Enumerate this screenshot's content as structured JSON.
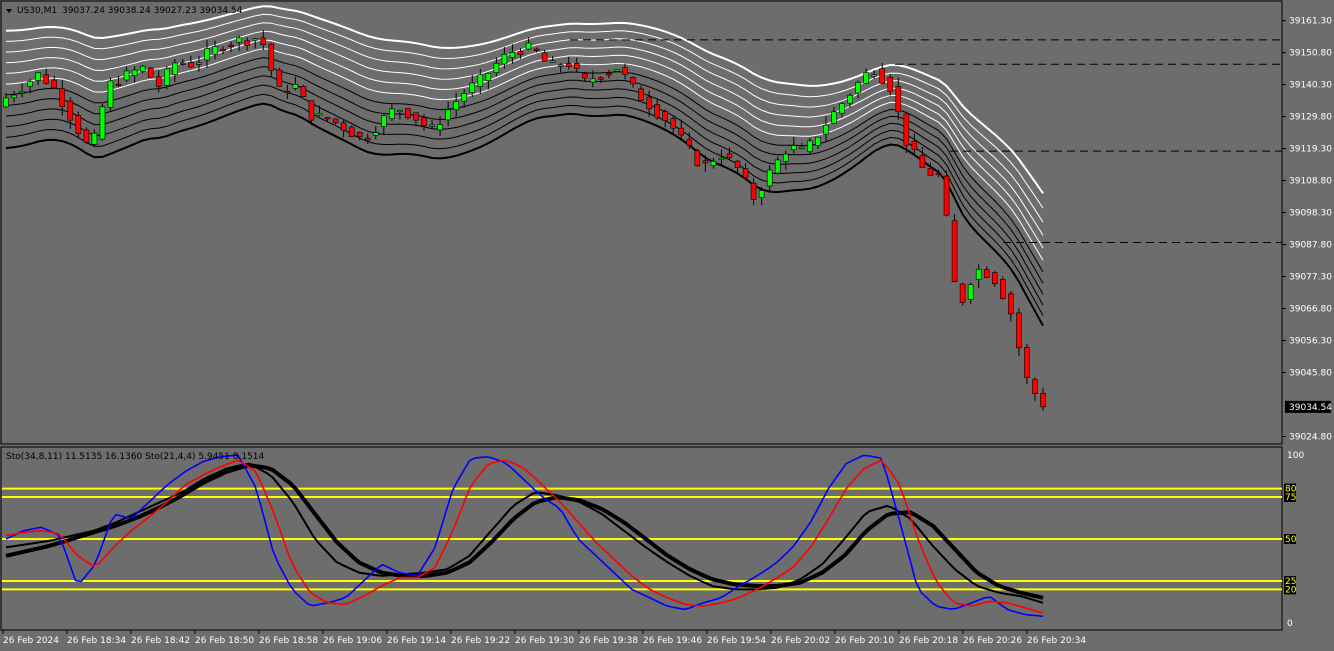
{
  "header": {
    "symbol": "US30,M1",
    "ohlc": "39037.24 39038.24 39027.23 39034.54"
  },
  "indicator": {
    "label": "Sto(34,8,11) 11.5135 16.1360  Sto(21,4,4) 5.9451 8.1514"
  },
  "colors": {
    "background": "#6d6d6d",
    "bull_candle": "#00ff00",
    "bear_candle": "#ff0000",
    "level_line": "#ffff00",
    "stoch_fast_main": "#0000ff",
    "stoch_fast_signal": "#ff0000",
    "stoch_slow_lines": "#000000",
    "ribbon_upper": "#ffffff",
    "ribbon_lower": "#000000"
  },
  "chart_data": [
    {
      "type": "candlestick",
      "title": "US30,M1",
      "price_axis_labels": [
        "39161.30",
        "39150.80",
        "39140.30",
        "39129.80",
        "39119.30",
        "39108.80",
        "39098.30",
        "39087.80",
        "39077.30",
        "39066.80",
        "39056.30",
        "39045.80",
        "39034.54",
        "39024.80"
      ],
      "ylim": [
        39023.0,
        39163.5
      ],
      "current_price": 39034.54,
      "horizontal_dashed_levels": [
        39155.0,
        39147.0,
        39118.5,
        39088.5
      ],
      "x_labels": [
        "26 Feb 2024",
        "26 Feb 18:34",
        "26 Feb 18:42",
        "26 Feb 18:50",
        "26 Feb 18:58",
        "26 Feb 19:06",
        "26 Feb 19:14",
        "26 Feb 19:22",
        "26 Feb 19:30",
        "26 Feb 19:38",
        "26 Feb 19:46",
        "26 Feb 19:54",
        "26 Feb 20:02",
        "26 Feb 20:10",
        "26 Feb 20:18",
        "26 Feb 20:26",
        "26 Feb 20:34"
      ],
      "close_path": [
        39136,
        39140,
        39144,
        39138,
        39128,
        39118,
        39140,
        39143,
        39146,
        39140,
        39148,
        39147,
        39151,
        39154,
        39155,
        39156,
        39138,
        39140,
        39130,
        39129,
        39126,
        39122,
        39128,
        39133,
        39130,
        39125,
        39132,
        39138,
        39142,
        39148,
        39152,
        39152,
        39146,
        39148,
        39141,
        39144,
        39146,
        39138,
        39133,
        39128,
        39120,
        39113,
        39118,
        39113,
        39103,
        39112,
        39120,
        39118,
        39126,
        39133,
        39140,
        39146,
        39140,
        39121,
        39112,
        39110,
        39066,
        39080,
        39078,
        39068,
        39044,
        39034.54
      ],
      "open_path": [
        39133,
        39134,
        39141,
        39145,
        39139,
        39129,
        39117,
        39139,
        39143,
        39147,
        39139,
        39149,
        39146,
        39152,
        39155,
        39157,
        39157,
        39137,
        39141,
        39131,
        39130,
        39125,
        39121,
        39129,
        39134,
        39131,
        39124,
        39133,
        39137,
        39141,
        39147,
        39155,
        39151,
        39145,
        39149,
        39140,
        39145,
        39145,
        39139,
        39134,
        39127,
        39121,
        39112,
        39119,
        39114,
        39102,
        39113,
        39121,
        39117,
        39127,
        39132,
        39141,
        39145,
        39141,
        39120,
        39113,
        39108,
        39067,
        39081,
        39077,
        39067,
        39043
      ]
    },
    {
      "type": "line",
      "title": "Sto(34,8,11) 11.5135 16.1360  Sto(21,4,4) 5.9451 8.1514",
      "ylim": [
        0,
        100
      ],
      "y_axis_labels": [
        "100",
        "0"
      ],
      "levels": [
        80,
        75,
        50,
        25,
        20
      ],
      "series": [
        {
          "values": [
            50,
            55,
            57,
            52,
            22,
            35,
            65,
            62,
            72,
            82,
            90,
            96,
            99,
            100,
            80,
            40,
            20,
            10,
            12,
            15,
            25,
            35,
            30,
            28,
            45,
            80,
            98,
            99,
            95,
            85,
            75,
            68,
            50,
            40,
            30,
            20,
            15,
            10,
            8,
            12,
            15,
            22,
            28,
            35,
            45,
            60,
            80,
            95,
            100,
            98,
            60,
            20,
            10,
            8,
            12,
            16,
            8,
            5,
            4
          ],
          "signal": [
            52,
            54,
            55,
            53,
            40,
            33,
            45,
            55,
            63,
            72,
            82,
            88,
            93,
            97,
            90,
            65,
            35,
            18,
            12,
            11,
            16,
            22,
            27,
            27,
            33,
            55,
            82,
            95,
            97,
            92,
            82,
            72,
            60,
            48,
            38,
            28,
            20,
            15,
            11,
            10,
            12,
            15,
            20,
            26,
            33,
            45,
            62,
            80,
            92,
            97,
            82,
            50,
            25,
            12,
            10,
            13,
            12,
            9,
            6
          ]
        },
        {
          "slow_a": [
            45,
            47,
            49,
            52,
            55,
            60,
            66,
            72,
            78,
            86,
            92,
            95,
            88,
            72,
            50,
            36,
            30,
            28,
            29,
            30,
            32,
            40,
            55,
            70,
            78,
            76,
            72,
            65,
            55,
            45,
            36,
            28,
            22,
            20,
            20,
            21,
            26,
            35,
            50,
            66,
            70,
            62,
            46,
            32,
            22,
            18,
            16,
            12
          ],
          "slow_b": [
            40,
            43,
            46,
            50,
            54,
            58,
            63,
            69,
            76,
            84,
            90,
            94,
            92,
            82,
            65,
            48,
            36,
            30,
            28,
            28,
            30,
            36,
            48,
            62,
            72,
            75,
            73,
            68,
            60,
            50,
            40,
            32,
            26,
            23,
            22,
            22,
            24,
            30,
            40,
            55,
            65,
            66,
            58,
            44,
            30,
            22,
            18,
            15
          ]
        }
      ]
    }
  ]
}
